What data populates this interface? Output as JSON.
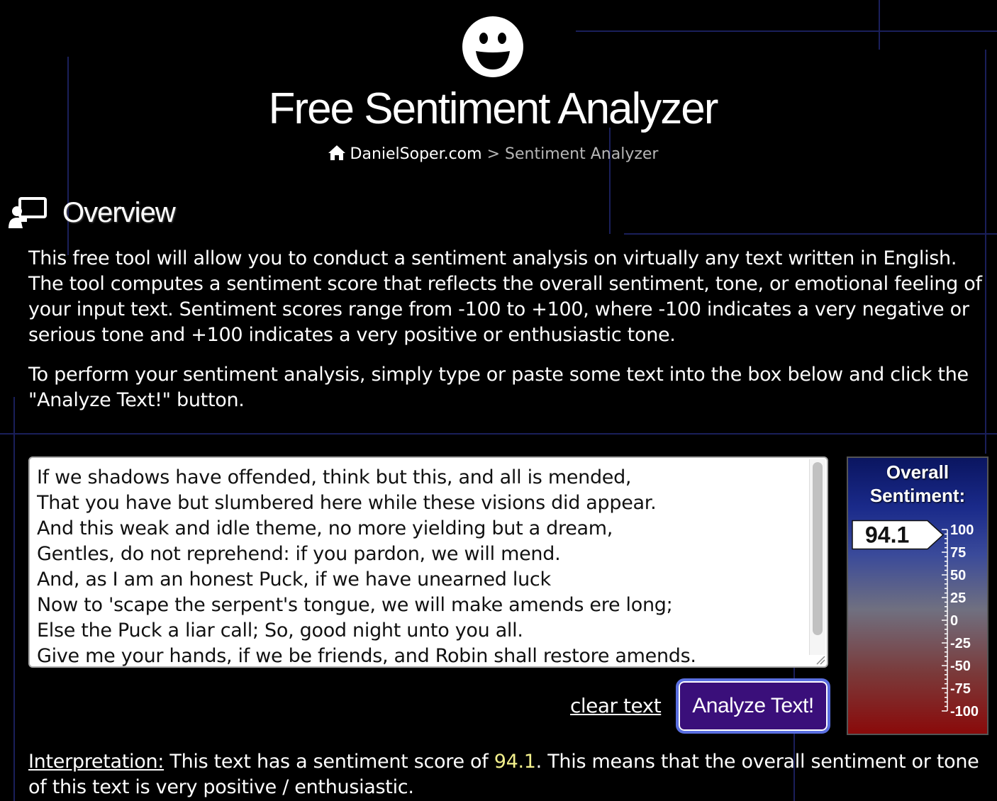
{
  "header": {
    "title": "Free Sentiment Analyzer",
    "breadcrumb": {
      "home": "DanielSoper.com",
      "separator": ">",
      "current": "Sentiment Analyzer"
    }
  },
  "overview": {
    "heading": "Overview",
    "paragraph1": "This free tool will allow you to conduct a sentiment analysis on virtually any text written in English. The tool computes a sentiment score that reflects the overall sentiment, tone, or emotional feeling of your input text. Sentiment scores range from -100 to +100, where -100 indicates a very negative or serious tone and +100 indicates a very positive or enthusiastic tone.",
    "paragraph2": "To perform your sentiment analysis, simply type or paste some text into the box below and click the \"Analyze Text!\" button."
  },
  "input": {
    "text": "If we shadows have offended, think but this, and all is mended,\nThat you have but slumbered here while these visions did appear.\nAnd this weak and idle theme, no more yielding but a dream,\nGentles, do not reprehend: if you pardon, we will mend.\nAnd, as I am an honest Puck, if we have unearned luck\nNow to 'scape the serpent's tongue, we will make amends ere long;\nElse the Puck a liar call; So, good night unto you all.\nGive me your hands, if we be friends, and Robin shall restore amends."
  },
  "actions": {
    "clear_label": "clear text",
    "analyze_label": "Analyze Text!"
  },
  "gauge": {
    "title": "Overall Sentiment:",
    "score": "94.1",
    "score_value": 94.1,
    "ticks": [
      "100",
      "75",
      "50",
      "25",
      "0",
      "-25",
      "-50",
      "-75",
      "-100"
    ]
  },
  "interpretation": {
    "label": "Interpretation:",
    "before": " This text has a sentiment score of ",
    "score": "94.1",
    "after": ". This means that the overall sentiment or tone of this text is very positive / enthusiastic."
  },
  "colors": {
    "button_bg": "#3a0f7a",
    "button_border": "#5a6fe0",
    "score_highlight": "#f3f08c"
  }
}
